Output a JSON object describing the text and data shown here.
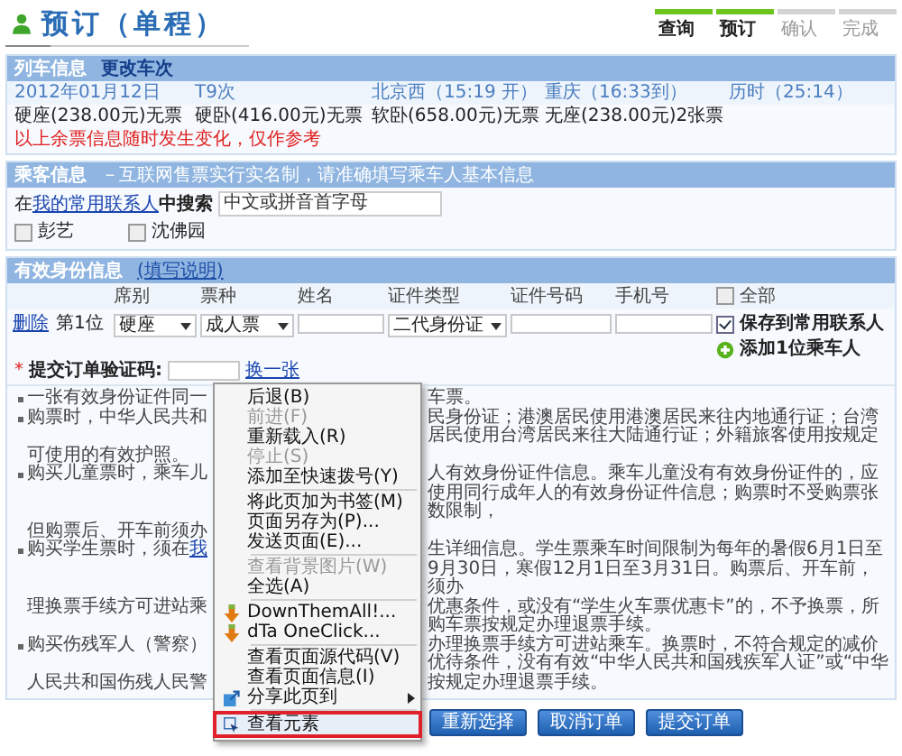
{
  "page_title": "预订（单程）",
  "steps": [
    {
      "label": "查询",
      "done": true
    },
    {
      "label": "预订",
      "done": true
    },
    {
      "label": "确认",
      "done": false
    },
    {
      "label": "完成",
      "done": false
    }
  ],
  "train_info": {
    "title": "列车信息",
    "change_link": "更改车次",
    "details": [
      "2012年01月12日",
      "T9次",
      "北京西（15:19 开）",
      "重庆（16:33到）",
      "历时（25:14）"
    ],
    "seats": [
      "硬座(238.00元)无票",
      "硬卧(416.00元)无票",
      "软卧(658.00元)无票",
      "无座(238.00元)2张票"
    ],
    "note": "以上余票信息随时发生变化，仅作参考"
  },
  "passenger_info": {
    "title": "乘客信息",
    "subtitle": "－互联网售票实行实名制，请准确填写乘车人基本信息",
    "search_prefix": "在",
    "contacts_link": "我的常用联系人",
    "search_suffix": "中搜索",
    "search": {
      "placeholder": "中文或拼音首字母"
    },
    "contacts": [
      {
        "name": "彭艺",
        "checked": false
      },
      {
        "name": "沈佛园",
        "checked": false
      }
    ]
  },
  "id_info": {
    "title": "有效身份信息",
    "help_link": "(填写说明)",
    "columns": [
      "席别",
      "票种",
      "姓名",
      "证件类型",
      "证件号码",
      "手机号"
    ],
    "select_all": {
      "label": "全部",
      "checked": false
    },
    "rows": [
      {
        "delete_link": "删除",
        "position": "第1位",
        "seat": "硬座",
        "ticket_type": "成人票",
        "id_type": "二代身份证",
        "save_contact": {
          "label": "保存到常用联系人",
          "checked": true
        }
      }
    ],
    "add_passenger": "添加1位乘车人",
    "captcha": {
      "required_mark": "*",
      "label": "提交订单验证码:",
      "refresh_link": "换一张"
    }
  },
  "notes": [
    {
      "bullet": true,
      "left": "一张有效身份证件同一",
      "right": "车票。"
    },
    {
      "bullet": true,
      "left": "购票时，中华人民共和",
      "right": "民身份证；港澳居民使用港澳居民来往内地通行证；台湾居民使用台湾居民来往大陆通行证；外籍旅客使用按规定"
    },
    {
      "bullet": false,
      "left": "可使用的有效护照。"
    },
    {
      "bullet": true,
      "left": "购买儿童票时，乘车儿",
      "right": "人有效身份证件信息。乘车儿童没有有效身份证件的，应使用同行成年人的有效身份证件信息；购票时不受购票张数限制，"
    },
    {
      "bullet": false,
      "left": "但购票后、开车前须办"
    },
    {
      "bullet": true,
      "left": "购买学生票时，须在",
      "link": "我",
      "right": "生详细信息。学生票乘车时间限制为每年的暑假6月1日至9月30日，寒假12月1日至3月31日。购票后、开车前，须办"
    },
    {
      "bullet": false,
      "left": "理换票手续方可进站乘",
      "right": "优惠条件，或没有“学生火车票优惠卡”的，不予换票，所购车票按规定办理退票手续。"
    },
    {
      "bullet": true,
      "left": "购买伤残军人（警察）",
      "right": "办理换票手续方可进站乘车。换票时，不符合规定的减价优待条件，没有有效“中华人民共和国残疾军人证”或“中华"
    },
    {
      "bullet": false,
      "left": "人民共和国伤残人民警",
      "right": "按规定办理退票手续。"
    }
  ],
  "context_menu": [
    {
      "kind": "item",
      "label": "后退(B)",
      "disabled": false,
      "highlighted": false
    },
    {
      "kind": "item",
      "label": "前进(F)",
      "disabled": true,
      "highlighted": false
    },
    {
      "kind": "item",
      "label": "重新载入(R)",
      "disabled": false,
      "highlighted": false
    },
    {
      "kind": "item",
      "label": "停止(S)",
      "disabled": true,
      "highlighted": false
    },
    {
      "kind": "item",
      "label": "添加至快速拨号(Y)",
      "disabled": false,
      "highlighted": false
    },
    {
      "kind": "separator"
    },
    {
      "kind": "item",
      "label": "将此页加为书签(M)",
      "disabled": false,
      "highlighted": false
    },
    {
      "kind": "item",
      "label": "页面另存为(P)...",
      "disabled": false,
      "highlighted": false
    },
    {
      "kind": "item",
      "label": "发送页面(E)...",
      "disabled": false,
      "highlighted": false
    },
    {
      "kind": "separator"
    },
    {
      "kind": "item",
      "label": "查看背景图片(W)",
      "disabled": true,
      "highlighted": false
    },
    {
      "kind": "item",
      "label": "全选(A)",
      "disabled": false,
      "highlighted": false
    },
    {
      "kind": "separator"
    },
    {
      "kind": "plugin",
      "label": "DownThemAll!...",
      "disabled": false,
      "highlighted": false
    },
    {
      "kind": "plugin",
      "label": "dTa OneClick...",
      "disabled": false,
      "highlighted": false
    },
    {
      "kind": "separator"
    },
    {
      "kind": "item",
      "label": "查看页面源代码(V)",
      "disabled": false,
      "highlighted": false
    },
    {
      "kind": "item",
      "label": "查看页面信息(I)",
      "disabled": false,
      "highlighted": false
    },
    {
      "kind": "submenu",
      "label": "分享此页到",
      "disabled": false,
      "highlighted": false
    },
    {
      "kind": "separator"
    },
    {
      "kind": "inspect",
      "label": "查看元素",
      "disabled": false,
      "highlighted": true
    }
  ],
  "buttons": [
    "重新选择",
    "取消订单",
    "提交订单"
  ]
}
